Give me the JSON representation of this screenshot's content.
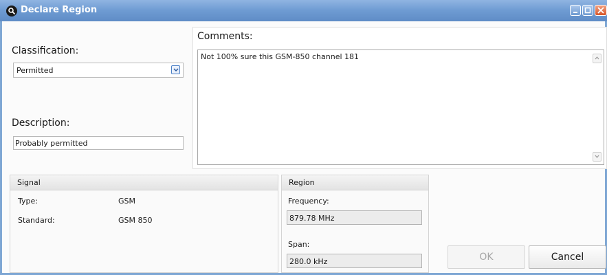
{
  "window": {
    "title": "Declare Region"
  },
  "classification": {
    "label": "Classification:",
    "selected": "Permitted"
  },
  "description": {
    "label": "Description:",
    "value": "Probably permitted"
  },
  "comments": {
    "label": "Comments:",
    "value": "Not 100% sure this GSM-850 channel 181"
  },
  "signal": {
    "title": "Signal",
    "type_label": "Type:",
    "type_value": "GSM",
    "standard_label": "Standard:",
    "standard_value": "GSM 850"
  },
  "region": {
    "title": "Region",
    "frequency_label": "Frequency:",
    "frequency_value": "879.78 MHz",
    "span_label": "Span:",
    "span_value": "280.0 kHz"
  },
  "buttons": {
    "ok": "OK",
    "cancel": "Cancel"
  },
  "icons": {
    "app": "magnifier-icon",
    "minimize": "minimize-icon",
    "maximize": "maximize-icon",
    "close": "close-icon"
  }
}
